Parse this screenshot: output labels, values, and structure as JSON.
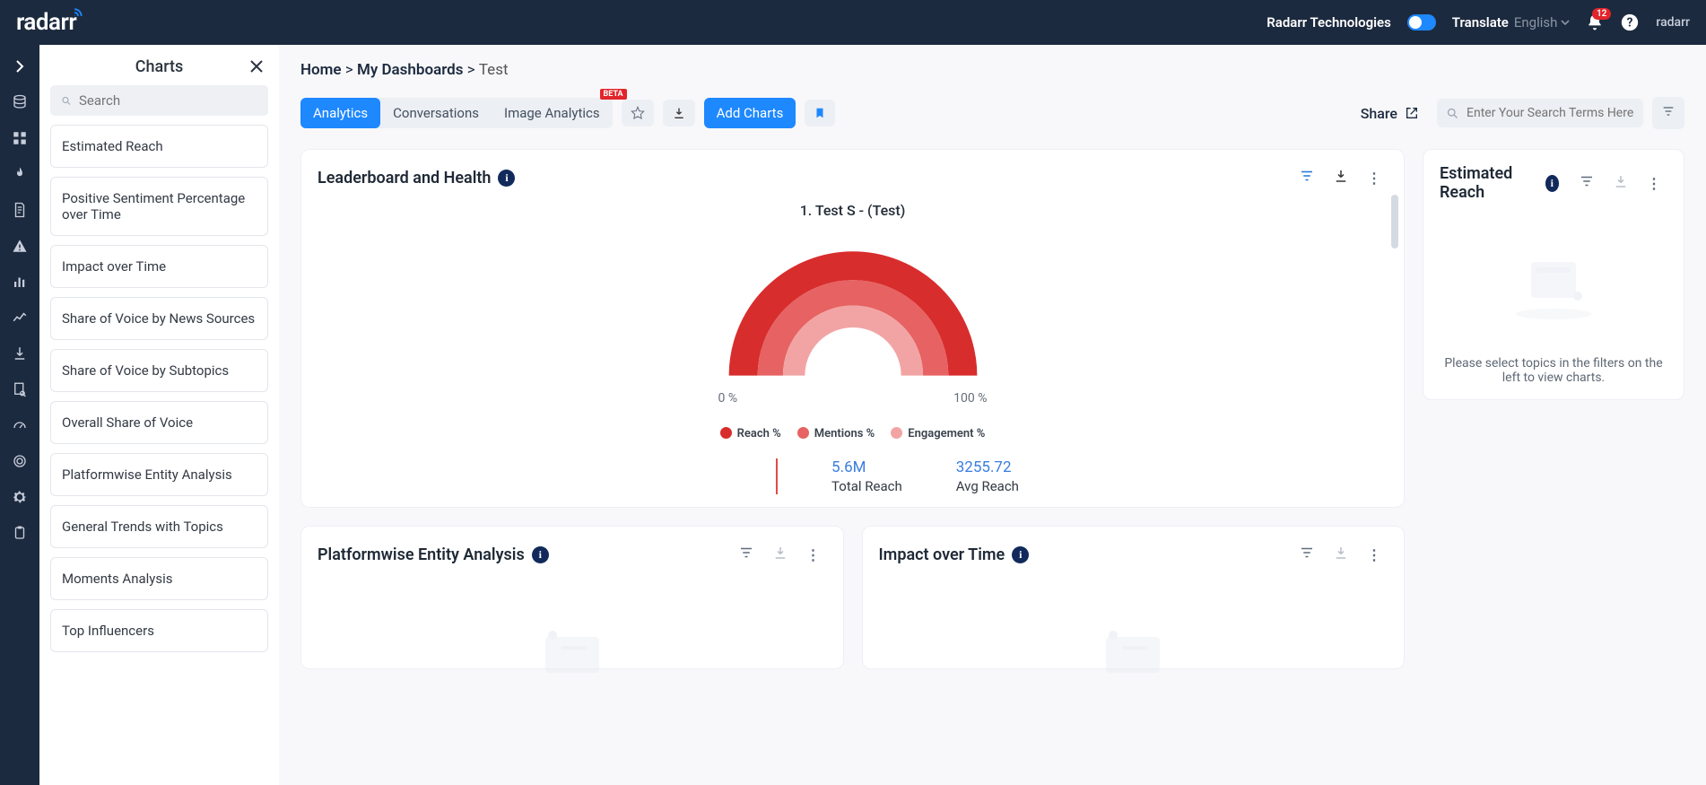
{
  "topbar": {
    "logo_text": "radarr",
    "company": "Radarr Technologies",
    "translate_label": "Translate",
    "language": "English",
    "notif_count": "12",
    "small_logo": "radarr"
  },
  "charts_panel": {
    "title": "Charts",
    "search_placeholder": "Search",
    "items": [
      "Estimated Reach",
      "Positive Sentiment Percentage over Time",
      "Impact over Time",
      "Share of Voice by News Sources",
      "Share of Voice by Subtopics",
      "Overall Share of Voice",
      "Platformwise Entity Analysis",
      "General Trends with Topics",
      "Moments Analysis",
      "Top Influencers"
    ]
  },
  "breadcrumb": {
    "home": "Home",
    "sep": ">",
    "my_dashboards": "My Dashboards",
    "current": "Test"
  },
  "toolbar": {
    "analytics": "Analytics",
    "conversations": "Conversations",
    "image_analytics": "Image Analytics",
    "beta": "BETA",
    "add_charts": "Add Charts",
    "share": "Share",
    "search_placeholder": "Enter Your Search Terms Here"
  },
  "cards": {
    "leaderboard": {
      "title": "Leaderboard and Health",
      "subtitle": "1. Test S - (Test)",
      "min_label": "0 %",
      "max_label": "100 %",
      "legend": {
        "reach": "Reach %",
        "mentions": "Mentions %",
        "engagement": "Engagement %"
      },
      "stats": {
        "total_reach_val": "5.6M",
        "total_reach_lbl": "Total Reach",
        "avg_reach_val": "3255.72",
        "avg_reach_lbl": "Avg Reach"
      }
    },
    "est_reach": {
      "title": "Estimated Reach",
      "empty_msg": "Please select topics in the filters on the left to view charts."
    },
    "pea": {
      "title": "Platformwise Entity Analysis"
    },
    "iot": {
      "title": "Impact over Time"
    }
  },
  "chart_data": {
    "type": "gauge",
    "title": "1. Test S - (Test)",
    "xlabel": "",
    "ylabel": "",
    "range": [
      0,
      100
    ],
    "unit": "%",
    "series": [
      {
        "name": "Reach %",
        "value": 100,
        "color": "#d82d2d"
      },
      {
        "name": "Mentions %",
        "value": 100,
        "color": "#e76262"
      },
      {
        "name": "Engagement %",
        "value": 100,
        "color": "#f2a4a4"
      }
    ],
    "stats": {
      "Total Reach": "5.6M",
      "Avg Reach": 3255.72
    }
  }
}
